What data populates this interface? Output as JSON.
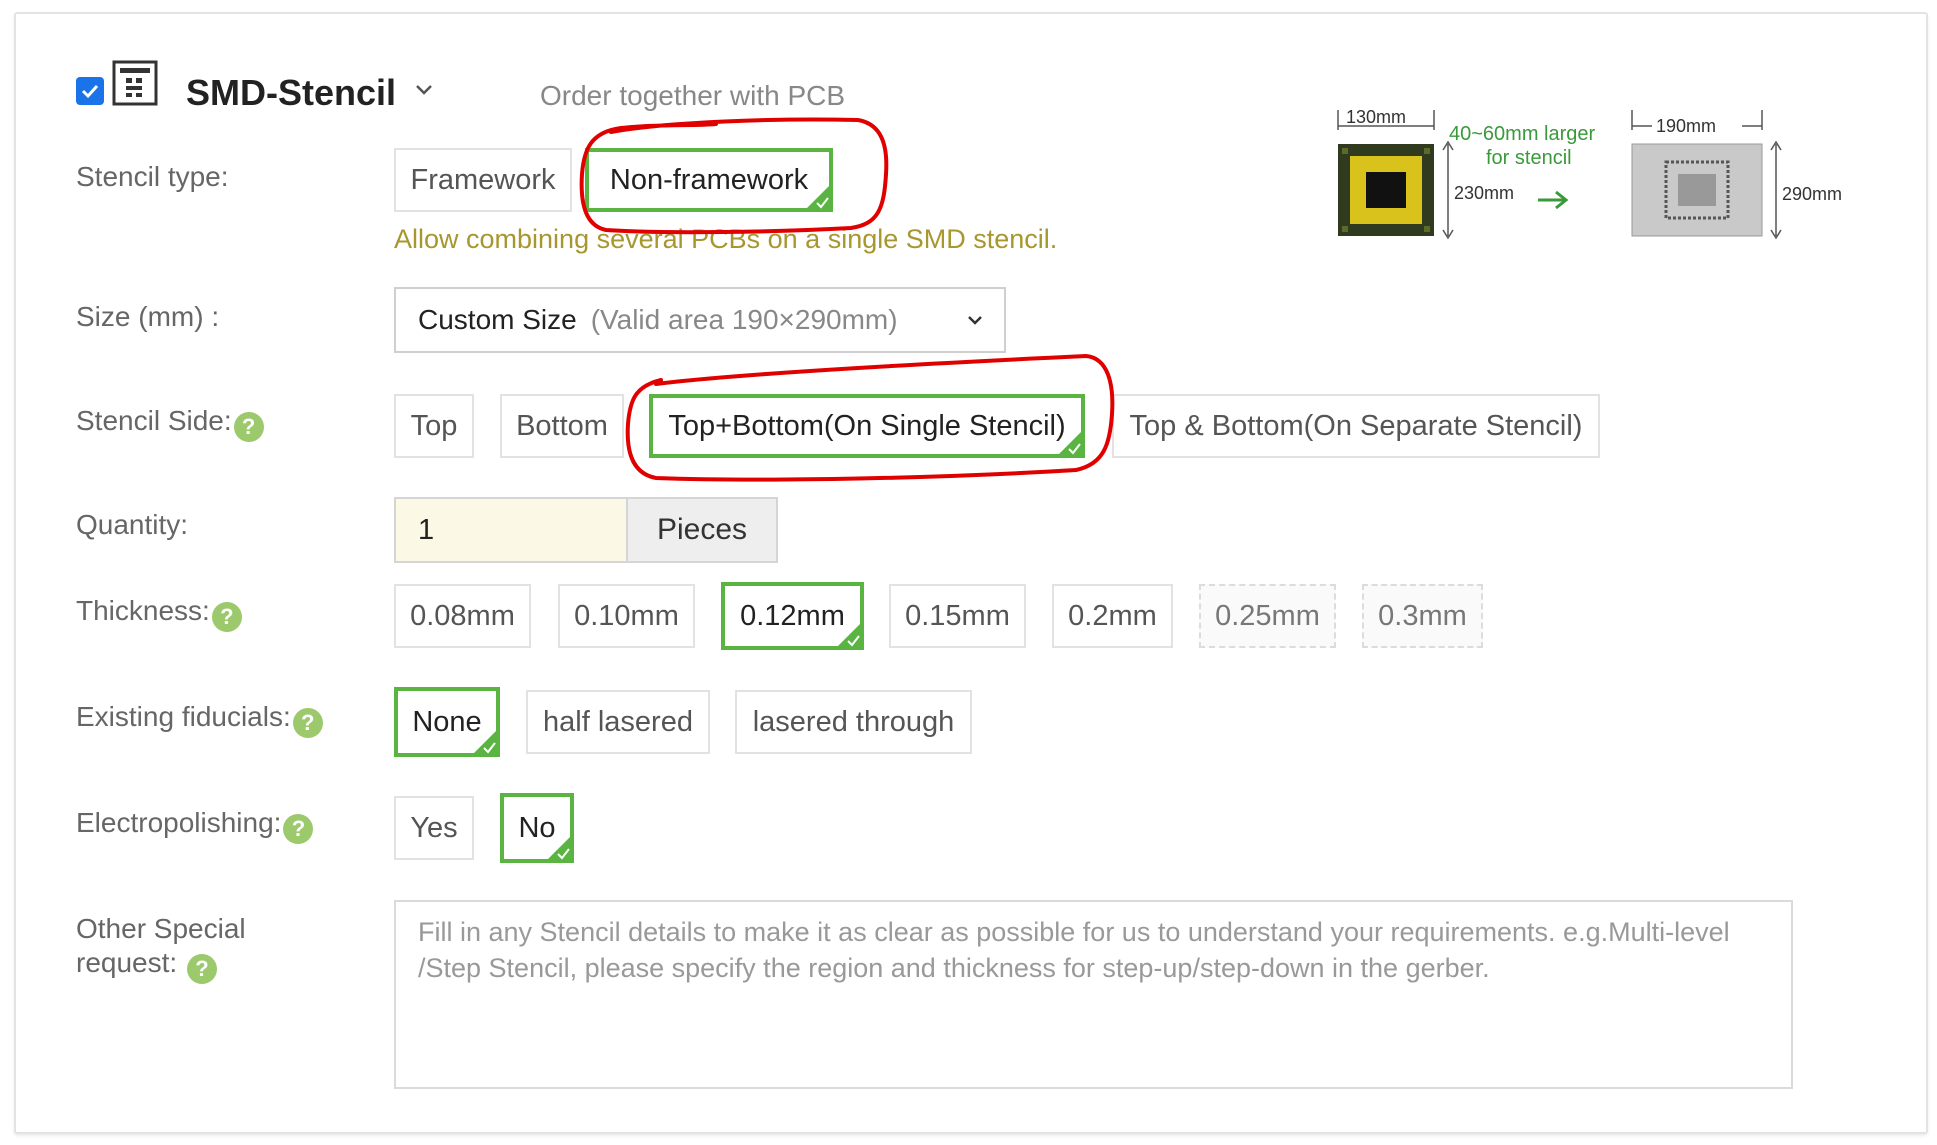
{
  "header": {
    "checked": true,
    "title": "SMD-Stencil",
    "subtitle": "Order together with PCB"
  },
  "stencil_type": {
    "label": "Stencil type:",
    "options": [
      "Framework",
      "Non-framework"
    ],
    "selected": "Non-framework",
    "hint": "Allow combining several PCBs on a single SMD stencil."
  },
  "diagram": {
    "dim1": "130mm",
    "dim2": "230mm",
    "note_line1": "40~60mm larger",
    "note_line2": "for stencil",
    "dim3": "190mm",
    "dim4": "290mm"
  },
  "size": {
    "label": "Size (mm) :",
    "value": "Custom Size",
    "sub": "(Valid area 190×290mm)"
  },
  "stencil_side": {
    "label": "Stencil Side:",
    "options": [
      "Top",
      "Bottom",
      "Top+Bottom(On Single Stencil)",
      "Top & Bottom(On Separate Stencil)"
    ],
    "selected": "Top+Bottom(On Single Stencil)"
  },
  "quantity": {
    "label": "Quantity:",
    "value": "1",
    "unit": "Pieces"
  },
  "thickness": {
    "label": "Thickness:",
    "options": [
      "0.08mm",
      "0.10mm",
      "0.12mm",
      "0.15mm",
      "0.2mm",
      "0.25mm",
      "0.3mm"
    ],
    "selected": "0.12mm",
    "disabled": [
      "0.25mm",
      "0.3mm"
    ]
  },
  "fiducials": {
    "label": "Existing fiducials:",
    "options": [
      "None",
      "half lasered",
      "lasered through"
    ],
    "selected": "None"
  },
  "electropolishing": {
    "label": "Electropolishing:",
    "options": [
      "Yes",
      "No"
    ],
    "selected": "No"
  },
  "special": {
    "label_line1": "Other Special",
    "label_line2": "request:",
    "placeholder": "Fill in any Stencil details to make it as clear as possible for us to understand your requirements. e.g.Multi-level /Step Stencil, please specify the region and thickness for step-up/step-down in the gerber."
  },
  "colors": {
    "selected_border": "#5ab442",
    "hint": "#a8962e",
    "annotation": "#e00000",
    "help_badge": "#9cc96c"
  }
}
